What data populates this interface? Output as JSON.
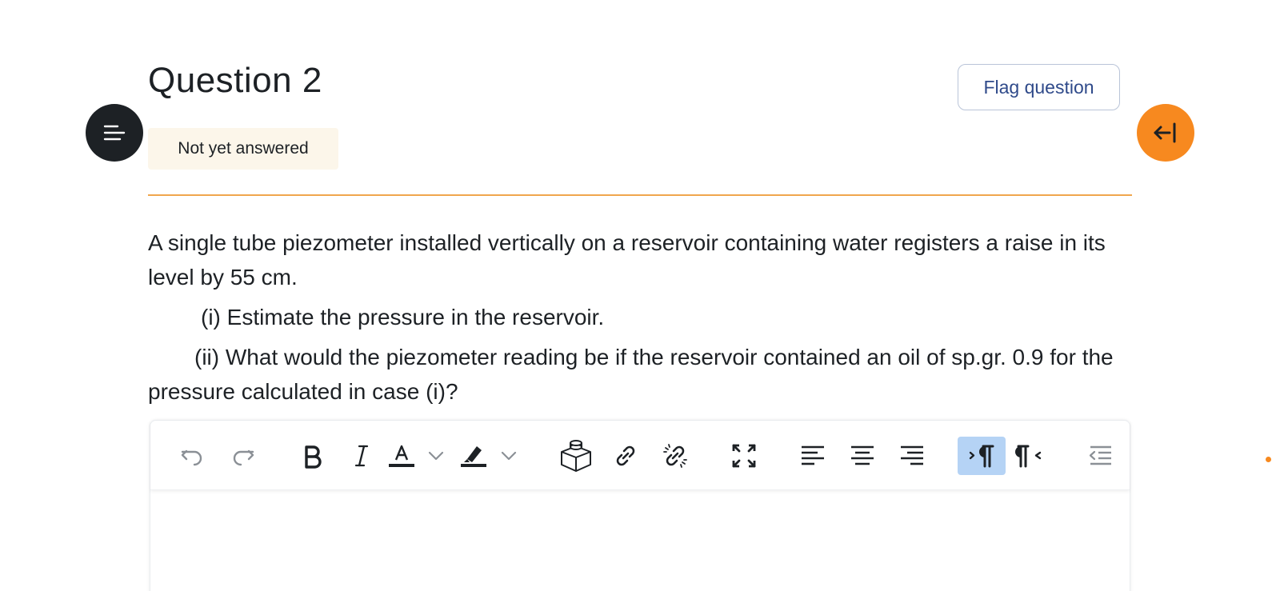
{
  "question": {
    "title": "Question 2",
    "status": "Not yet answered",
    "flag_label": "Flag question"
  },
  "question_text": {
    "intro": "A single tube piezometer installed vertically on a reservoir containing water registers a raise in its level by 55 cm.",
    "part_i": "(i) Estimate the pressure in the reservoir.",
    "part_ii": "(ii) What would the piezometer reading be if the reservoir contained an oil of sp.gr. 0.9 for the pressure calculated in case (i)?"
  },
  "toolbar": {
    "icons": [
      "undo-icon",
      "redo-icon",
      "bold-icon",
      "italic-icon",
      "text-color-icon",
      "chevron-down-icon",
      "highlight-icon",
      "chevron-down-icon",
      "block-icon",
      "link-icon",
      "unlink-icon",
      "fullscreen-icon",
      "align-left-icon",
      "align-center-icon",
      "align-right-icon",
      "ltr-icon",
      "rtl-icon",
      "outdent-icon"
    ],
    "active": "ltr-icon"
  },
  "colors": {
    "accent_orange": "#f7891f",
    "divider": "#f0a64d",
    "status_bg": "#fcf6ea",
    "flag_text": "#2f4a8a",
    "active_button": "#b5d3f5",
    "dark": "#1d2125"
  }
}
